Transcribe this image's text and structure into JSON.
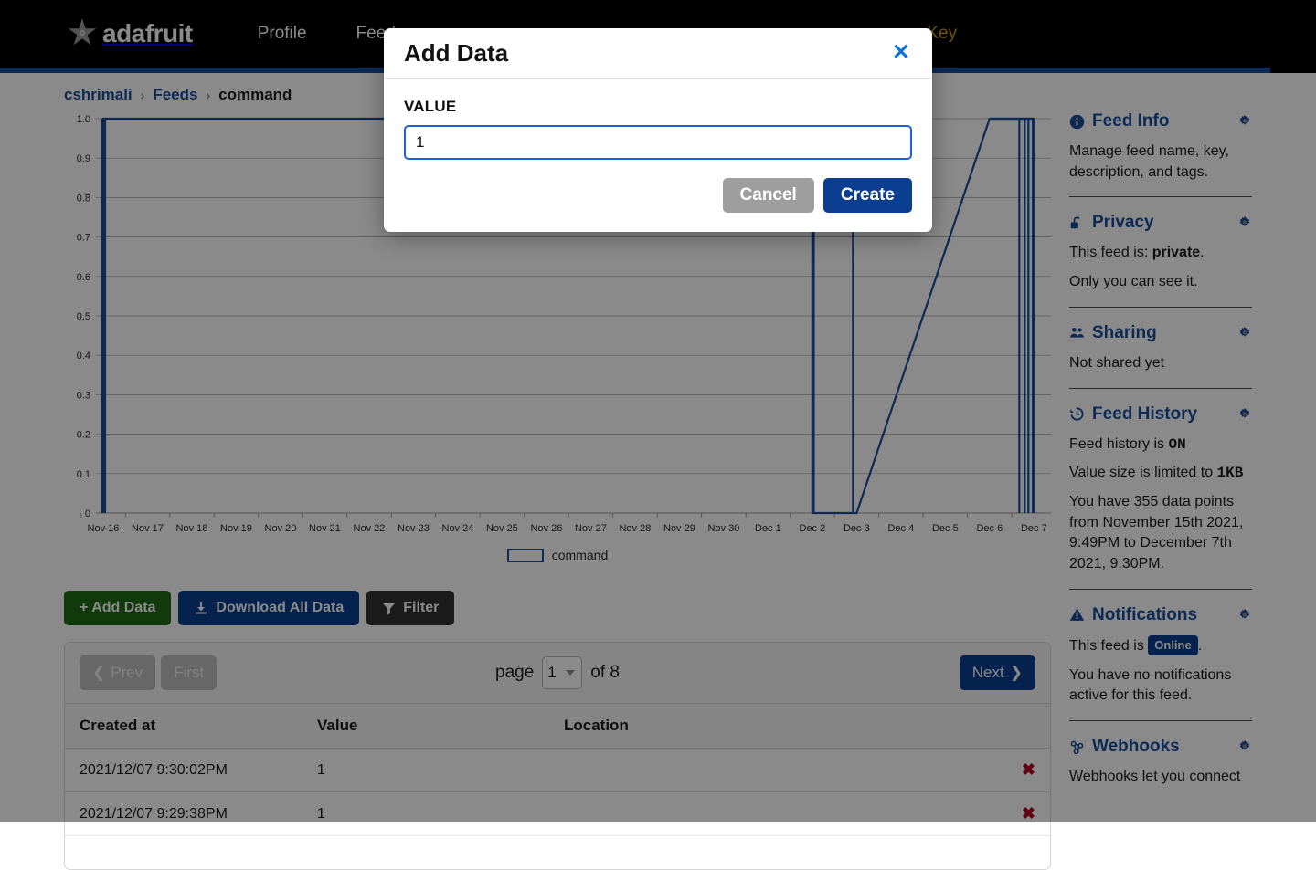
{
  "nav": {
    "brand": "adafruit",
    "brand_icon": "adafruit-flower-logo",
    "links": [
      {
        "label": "Profile",
        "accent": false
      },
      {
        "label": "Feeds",
        "accent": false
      },
      {
        "label": "Key",
        "accent": true
      }
    ]
  },
  "breadcrumb": {
    "user": "cshrimali",
    "sep": "›",
    "feeds": "Feeds",
    "current": "command"
  },
  "chart_data": {
    "type": "line",
    "title": "",
    "xlabel": "",
    "ylabel": "",
    "series": [
      {
        "name": "command",
        "color": "#1b4f9c",
        "points": [
          {
            "x": "Nov 16",
            "y": 1.0
          },
          {
            "x": "Nov 16",
            "y": 0.0
          },
          {
            "x": "Nov 16",
            "y": 1.0
          },
          {
            "x": "Dec 2",
            "y": 1.0
          },
          {
            "x": "Dec 2",
            "y": 0.0
          },
          {
            "x": "Dec 3",
            "y": 0.0
          },
          {
            "x": "Dec 6",
            "y": 1.0
          },
          {
            "x": "Dec 7",
            "y": 1.0
          },
          {
            "x": "Dec 7",
            "y": 0.0
          },
          {
            "x": "Dec 7",
            "y": 1.0
          },
          {
            "x": "Dec 7",
            "y": 0.0
          },
          {
            "x": "Dec 7",
            "y": 1.0
          }
        ]
      }
    ],
    "categories": [
      "Nov 16",
      "Nov 17",
      "Nov 18",
      "Nov 19",
      "Nov 20",
      "Nov 21",
      "Nov 22",
      "Nov 23",
      "Nov 24",
      "Nov 25",
      "Nov 26",
      "Nov 27",
      "Nov 28",
      "Nov 29",
      "Nov 30",
      "Dec 1",
      "Dec 2",
      "Dec 3",
      "Dec 4",
      "Dec 5",
      "Dec 6",
      "Dec 7"
    ],
    "ytick_labels": [
      "1.0",
      "0.9",
      "0.8",
      "0.7",
      "0.6",
      "0.5",
      "0.4",
      "0.3",
      "0.2",
      "0.1",
      "0"
    ],
    "ytick_values": [
      1.0,
      0.9,
      0.8,
      0.7,
      0.6,
      0.5,
      0.4,
      0.3,
      0.2,
      0.1,
      0.0
    ],
    "ylim": [
      0,
      1.0
    ],
    "grid": true,
    "legend": {
      "position": "bottom",
      "entries": [
        "command"
      ]
    }
  },
  "actions": {
    "add_data": "+ Add Data",
    "download": "Download All Data",
    "filter": "Filter"
  },
  "pager": {
    "prev": "Prev",
    "first": "First",
    "page_word": "page",
    "page_value": "1",
    "of_text": "of 8",
    "next": "Next"
  },
  "table": {
    "headers": [
      "Created at",
      "Value",
      "Location",
      ""
    ],
    "rows": [
      {
        "created": "2021/12/07 9:30:02PM",
        "value": "1",
        "location": "",
        "delete": "✖"
      },
      {
        "created": "2021/12/07 9:29:38PM",
        "value": "1",
        "location": "",
        "delete": "✖"
      }
    ]
  },
  "sidebar": {
    "sections": [
      {
        "icon": "info-circle-icon",
        "title": "Feed Info",
        "gear": "gear-icon",
        "body": [
          {
            "text": "Manage feed name, key, description, and tags."
          }
        ]
      },
      {
        "icon": "unlock-icon",
        "title": "Privacy",
        "gear": "gear-icon",
        "body": [
          {
            "pre": "This feed is: ",
            "strong": "private",
            "post": "."
          },
          {
            "text": "Only you can see it."
          }
        ]
      },
      {
        "icon": "users-icon",
        "title": "Sharing",
        "gear": "gear-icon",
        "body": [
          {
            "text": "Not shared yet"
          }
        ]
      },
      {
        "icon": "history-icon",
        "title": "Feed History",
        "gear": "gear-icon",
        "body": [
          {
            "pre": "Feed history is ",
            "mono": "ON"
          },
          {
            "pre": "Value size is limited to ",
            "mono": "1KB"
          },
          {
            "text": "You have 355 data points from November 15th 2021, 9:49PM to December 7th 2021, 9:30PM."
          }
        ]
      },
      {
        "icon": "warning-triangle-icon",
        "title": "Notifications",
        "gear": "gear-icon",
        "body": [
          {
            "pre": "This feed is ",
            "pill": "Online",
            "post": "."
          },
          {
            "text": "You have no notifications active for this feed."
          }
        ]
      },
      {
        "icon": "webhook-icon",
        "title": "Webhooks",
        "gear": "gear-icon",
        "body": [
          {
            "text": "Webhooks let you connect"
          }
        ]
      }
    ]
  },
  "modal": {
    "title": "Add Data",
    "close_icon": "close-x-icon",
    "field_label": "VALUE",
    "field_value": "1",
    "field_placeholder": "",
    "cancel": "Cancel",
    "create": "Create"
  },
  "colors": {
    "nav_bg": "#000000",
    "nav_accent_text": "#c9a227",
    "brand_blue": "#1b4f9c",
    "primary_blue": "#0b3d91",
    "link_blue": "#1b4f9c",
    "green": "#1e6b16",
    "dark_btn": "#333333",
    "delete_red": "#b4001e",
    "focus_blue": "#1b63d0",
    "close_blue": "#0b72d8",
    "disabled_gray": "#bfbfbf",
    "cancel_gray": "#9e9e9e"
  }
}
